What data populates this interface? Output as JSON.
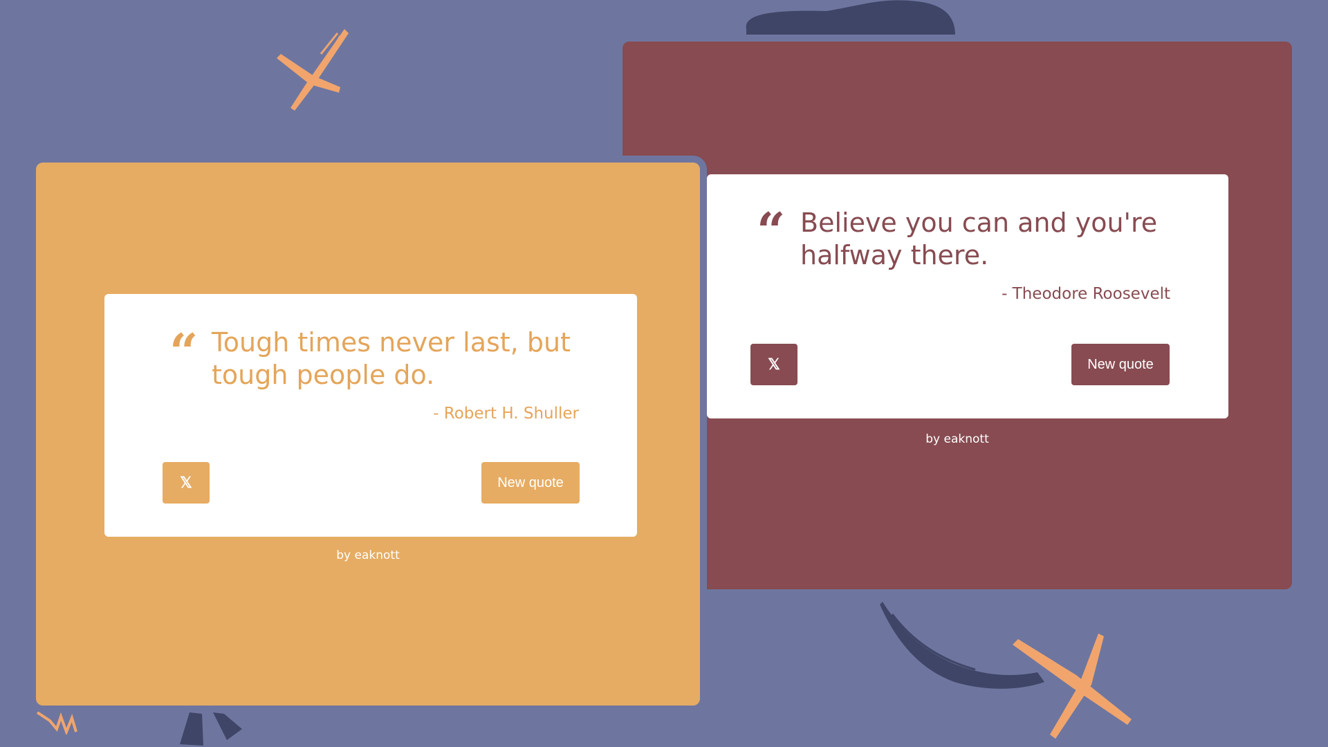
{
  "colors": {
    "background": "#6e76a0",
    "orange": "#e6ac63",
    "maroon": "#874b51",
    "navy_brush": "#3f4566",
    "peach_brush": "#f1a56c"
  },
  "cards": {
    "orange": {
      "quote_icon": "quote-left-icon",
      "quote": "Tough times never last, but tough people do.",
      "author": "- Robert H. Shuller",
      "share_icon": "x-twitter-icon",
      "share_glyph": "𝕏",
      "new_quote_label": "New quote",
      "credit": "by eaknott"
    },
    "maroon": {
      "quote_icon": "quote-left-icon",
      "quote": "Believe you can and you're halfway there.",
      "author": "- Theodore Roosevelt",
      "share_icon": "x-twitter-icon",
      "share_glyph": "𝕏",
      "new_quote_label": "New quote",
      "credit": "by eaknott"
    }
  }
}
